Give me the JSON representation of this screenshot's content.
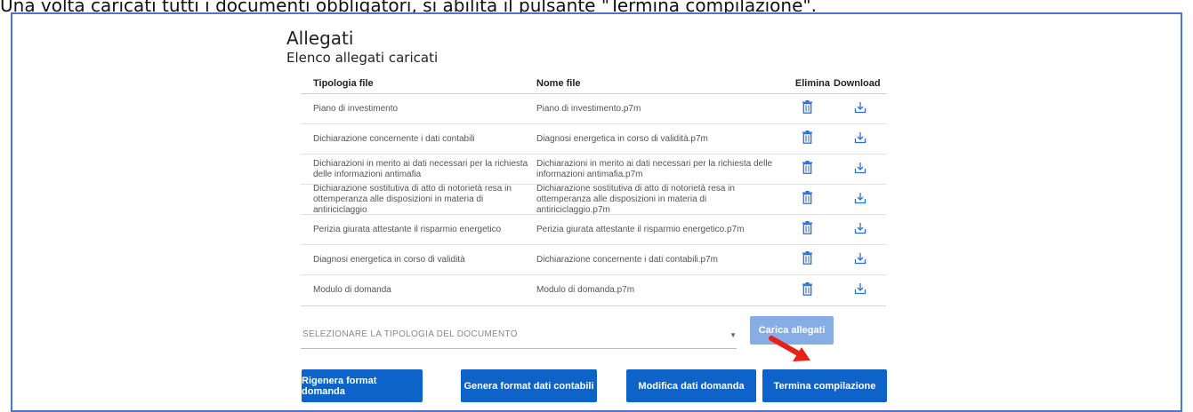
{
  "caption": "Una volta caricati tutti i documenti obbligatori, si abilita il pulsante \"Termina compilazione\".",
  "section": {
    "title": "Allegati",
    "subtitle": "Elenco allegati caricati"
  },
  "table": {
    "headers": {
      "type": "Tipologia file",
      "name": "Nome file",
      "delete": "Elimina",
      "download": "Download"
    },
    "rows": [
      {
        "type": "Piano di investimento",
        "name": "Piano di investimento.p7m"
      },
      {
        "type": "Dichiarazione concernente i dati contabili",
        "name": "Diagnosi energetica in corso di validità.p7m"
      },
      {
        "type": "Dichiarazioni in merito ai dati necessari per la richiesta delle informazioni antimafia",
        "name": "Dichiarazioni in merito ai dati necessari per la richiesta delle informazioni antimafia.p7m"
      },
      {
        "type": "Dichiarazione sostitutiva di atto di notorietà resa in ottemperanza alle disposizioni in materia di antiriciclaggio",
        "name": "Dichiarazione sostitutiva di atto di notorietà resa in ottemperanza alle disposizioni in materia di antiriciclaggio.p7m"
      },
      {
        "type": "Perizia giurata attestante il risparmio energetico",
        "name": "Perizia giurata attestante il risparmio energetico.p7m"
      },
      {
        "type": "Diagnosi energetica in corso di validità",
        "name": "Dichiarazione concernente i dati contabili.p7m"
      },
      {
        "type": "Modulo di domanda",
        "name": "Modulo di domanda.p7m"
      }
    ]
  },
  "upload": {
    "select_placeholder": "SELEZIONARE LA TIPOLOGIA DEL DOCUMENTO",
    "button": "Carica allegati"
  },
  "actions": {
    "regenerate": "Rigenera format domanda",
    "generate": "Genera format dati contabili",
    "modify": "Modifica dati domanda",
    "finish": "Termina compilazione"
  },
  "icons": {
    "delete": "trash-icon",
    "download": "download-icon",
    "select": "chevron-down-icon",
    "annotation": "red-arrow"
  },
  "colors": {
    "primary": "#0d63c7",
    "disabled": "#86aee5",
    "frame": "#4a78c2",
    "annotation": "#e8201a",
    "icon": "#2a6fd0"
  }
}
